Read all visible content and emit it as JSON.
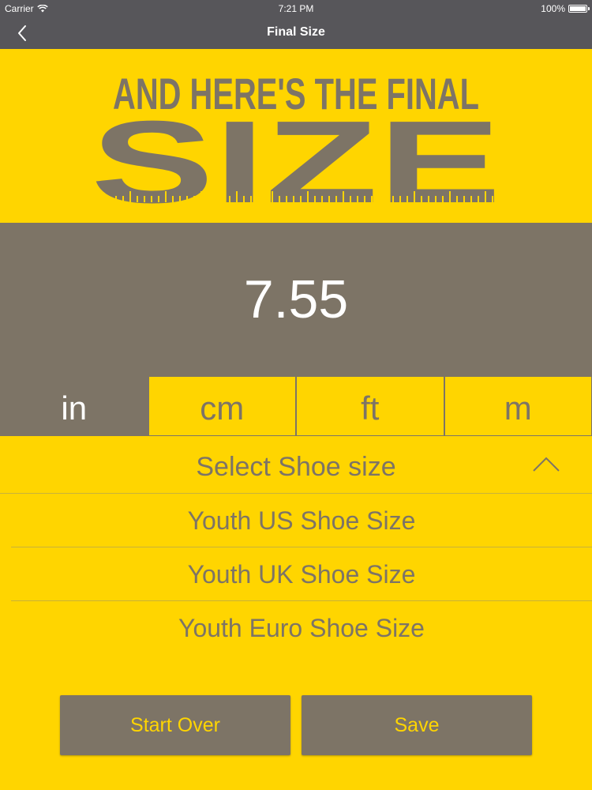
{
  "status": {
    "carrier": "Carrier",
    "time": "7:21 PM",
    "battery_text": "100%",
    "battery_level": 1.0
  },
  "nav": {
    "title": "Final Size"
  },
  "hero": {
    "line1": "AND HERE'S THE FINAL",
    "line2": "SIZE"
  },
  "result": {
    "value": "7.55"
  },
  "units": [
    {
      "label": "in",
      "active": true
    },
    {
      "label": "cm",
      "active": false
    },
    {
      "label": "ft",
      "active": false
    },
    {
      "label": "m",
      "active": false
    }
  ],
  "shoe": {
    "header": "Select Shoe size",
    "options": [
      "Youth US Shoe Size",
      "Youth UK Shoe Size",
      "Youth Euro Shoe Size"
    ]
  },
  "buttons": {
    "start_over": "Start Over",
    "save": "Save"
  },
  "colors": {
    "brand_yellow": "#ffd500",
    "olive_gray": "#7d7466",
    "bar_gray": "#57565a"
  }
}
